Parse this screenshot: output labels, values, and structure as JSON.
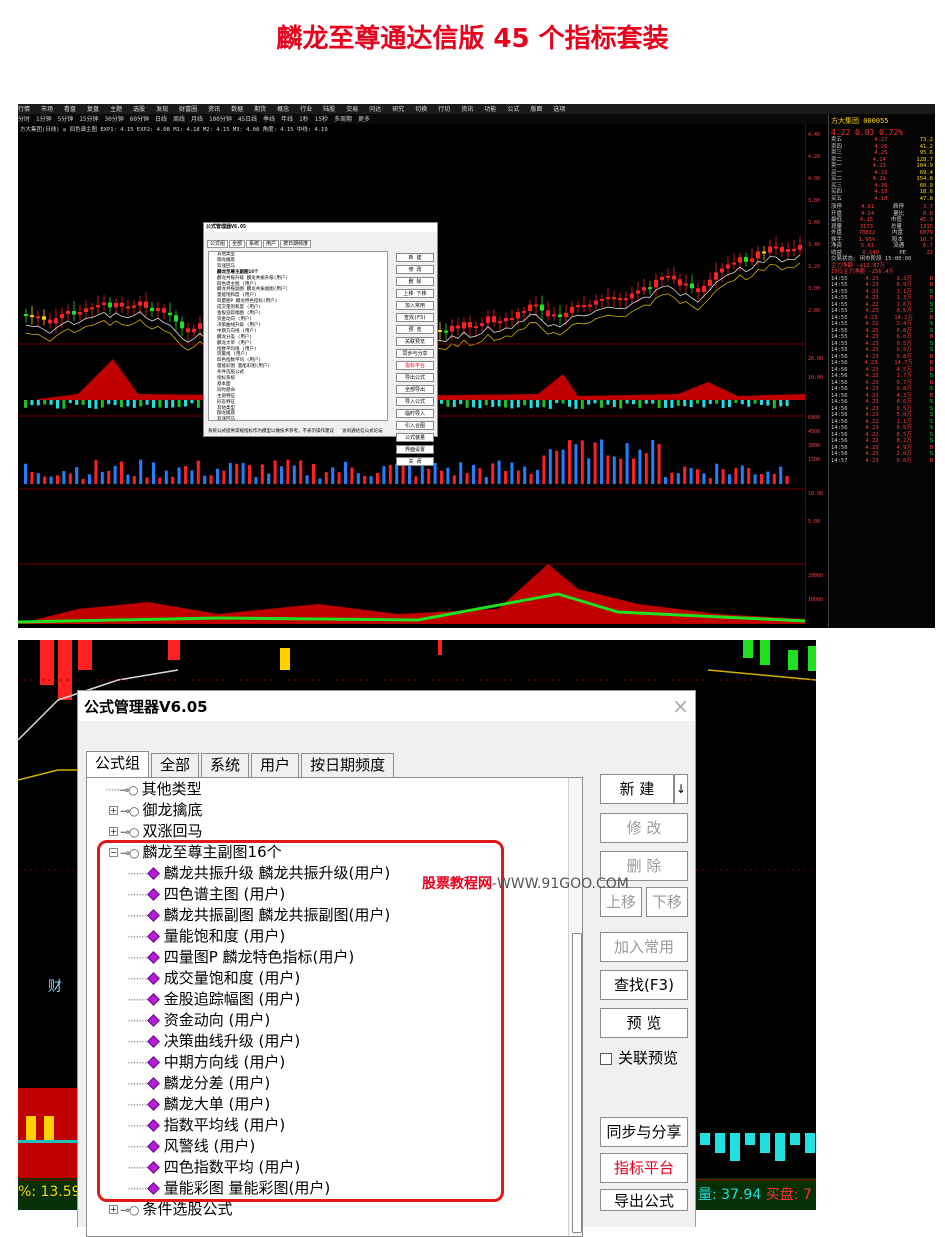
{
  "title": "麟龙至尊通达信版 45 个指标套装",
  "shot1": {
    "menu": [
      "行情",
      "市场",
      "看盘",
      "复盘",
      "主题",
      "选股",
      "发现",
      "财富圈",
      "资讯",
      "数据",
      "期货",
      "概念",
      "行业",
      "陆股",
      "交易",
      "问达",
      "研究",
      "切换",
      "行切",
      "资讯"
    ],
    "menu_right": [
      "功能",
      "公式",
      "版面",
      "选项"
    ],
    "toolbar": [
      "分时",
      "1分钟",
      "5分钟",
      "15分钟",
      "30分钟",
      "60分钟",
      "日线",
      "周线",
      "月线",
      "100分钟",
      "45日线",
      "季线",
      "年线",
      "1秒",
      "15秒",
      "多周期",
      "更多"
    ],
    "indicator_line": "方大集团(日线) ◎ 四色谱主图 EXP1: 4.15 EXP2: 4.08 M1: 4.18 M2: 4.15 M3: 4.08 角度: 4.15 中线: 4.19",
    "stock_name": "方大集团 000055",
    "price_line": "4.22  0.03  0.72%",
    "order_book": [
      [
        "卖五",
        "4.27",
        "73.2"
      ],
      [
        "卖四",
        "4.26",
        "41.2"
      ],
      [
        "卖三",
        "4.25",
        "95.6"
      ],
      [
        "卖二",
        "4.24",
        "128.7"
      ],
      [
        "卖一",
        "4.23",
        "104.9"
      ],
      [
        "买一",
        "4.22",
        "69.4"
      ],
      [
        "买二",
        "4.21",
        "154.8"
      ],
      [
        "买三",
        "4.20",
        "60.9"
      ],
      [
        "买四",
        "4.19",
        "18.6"
      ],
      [
        "买五",
        "4.18",
        "47.8"
      ]
    ],
    "stats": [
      [
        "涨停",
        "4.61",
        "跌停",
        "3.7"
      ],
      [
        "开盘",
        "4.24",
        "量比",
        "0.8"
      ],
      [
        "最低",
        "4.15",
        "市值",
        "45.3"
      ],
      [
        "现量",
        "3173",
        "总量",
        "1315"
      ],
      [
        "外盘",
        "70812",
        "内盘",
        "6079"
      ],
      [
        "换手",
        "1.95%",
        "股本",
        "10.7"
      ],
      [
        "净资",
        "5.61",
        "流通",
        "6.7"
      ],
      [
        "收益",
        "0.140",
        "PE",
        "22"
      ]
    ],
    "status_line": "交易状态: 闭市阶段 15:00:00",
    "flow1": "主力净额 -$13.87万",
    "flow2": "10日主力净额 -256.4万",
    "axis_labels": [
      "4.40",
      "4.20",
      "4.00",
      "3.80",
      "3.60",
      "3.40",
      "3.20",
      "3.00",
      "2.80",
      "20.00",
      "10.00",
      "6000",
      "4500",
      "3000",
      "1500",
      "10.00",
      "5.00",
      "20000",
      "10000"
    ],
    "high_label": "4.57",
    "low_label": "3.15",
    "pane_labels": [
      "主力资金 0.76",
      "成交量和幅度 量: 131566.00 资金净收支: 752.00 成交近剩幅: 13.59",
      "麟龙共振升级",
      "量能彩图 MA1: 144783.25 MA2: 122054.26 MA3: 107160.82"
    ],
    "small_dialog": {
      "title": "公式管理器V6.05",
      "tabs": [
        "公式组",
        "全部",
        "系统",
        "用户",
        "按日期频度"
      ],
      "tree": [
        "其他类型",
        "御龙擒底",
        "双涨回马",
        "麟龙至尊主副图16个",
        "麟龙共振升级 麟龙共振升级(用户)",
        "四色谱主图 (用户)",
        "麟龙共振副图 麟龙共振副图(用户)",
        "量能饱和度 (用户)",
        "四量图P 麟龙特色指标(用户)",
        "成交量饱和度 (用户)",
        "金股追踪幅图 (用户)",
        "资金动向 (用户)",
        "决策曲线升级 (用户)",
        "中期方向线 (用户)",
        "麟龙分差 (用户)",
        "麟龙大单 (用户)",
        "指数平均线 (用户)",
        "风警线 (用户)",
        "四色指数平均 (用户)",
        "量能彩图 量能彩图(用户)",
        "条件选股公式",
        "指标系统",
        "基本面",
        "同时盘命",
        "主助特征",
        "形态特征",
        "其他类型",
        "御龙擒底",
        "双涨回马",
        "麟龙至尊副图3个",
        "决策曲线信号 (用户)",
        "金股追踪 金股追踪幅图外图(用户)",
        "四量买红 第一天(用户)",
        "四色变红 四色谱变红第一天(用户)"
      ],
      "buttons": [
        "新 建",
        "修 改",
        "删 除",
        "上移  下移",
        "加入常用",
        "查找(F3)",
        "预 览",
        "关联预览",
        "同步与分享",
        "指标平台",
        "导出公式",
        "全部导出",
        "导入公式",
        "临时导入",
        "引入合图",
        "公式装量",
        "界面设置",
        "关 闭"
      ],
      "status": "系统公式提供常规指标作为模型以做技术参考，不表示操作建议",
      "status2": "访问通达信公式论坛"
    },
    "tick_rows": [
      [
        "14:55",
        "4.23",
        "3.3万",
        "B"
      ],
      [
        "14:55",
        "4.23",
        "6.9万",
        "B"
      ],
      [
        "14:55",
        "4.23",
        "1.1万",
        "S"
      ],
      [
        "14:55",
        "4.23",
        "1.3万",
        "B"
      ],
      [
        "14:55",
        "4.22",
        "1.6万",
        "S"
      ],
      [
        "14:55",
        "4.23",
        "0.5万",
        "S"
      ],
      [
        "14:55",
        "4.23",
        "14.2万",
        "B"
      ],
      [
        "14:55",
        "4.22",
        "2.4万",
        "S"
      ],
      [
        "14:55",
        "4.23",
        "0.8万",
        "S"
      ],
      [
        "14:55",
        "4.23",
        "6.0万",
        "B"
      ],
      [
        "14:55",
        "4.23",
        "0.5万",
        "S"
      ],
      [
        "14:55",
        "4.23",
        "0.5万",
        "S"
      ],
      [
        "14:56",
        "4.23",
        "0.8万",
        "B"
      ],
      [
        "14:56",
        "4.23",
        "14.7万",
        "B"
      ],
      [
        "14:56",
        "4.23",
        "4.5万",
        "B"
      ],
      [
        "14:56",
        "4.23",
        "1.7万",
        "S"
      ],
      [
        "14:56",
        "4.23",
        "0.7万",
        "B"
      ],
      [
        "14:56",
        "4.23",
        "0.8万",
        "S"
      ],
      [
        "14:56",
        "4.23",
        "4.3万",
        "B"
      ],
      [
        "14:56",
        "4.23",
        "0.6万",
        "S"
      ],
      [
        "14:56",
        "4.23",
        "0.5万",
        "S"
      ],
      [
        "14:56",
        "4.23",
        "5.0万",
        "S"
      ],
      [
        "14:56",
        "4.22",
        "1.1万",
        "S"
      ],
      [
        "14:56",
        "4.23",
        "0.5万",
        "S"
      ],
      [
        "14:56",
        "4.22",
        "8.5万",
        "S"
      ],
      [
        "14:56",
        "4.22",
        "0.2万",
        "S"
      ],
      [
        "14:56",
        "4.23",
        "4.9万",
        "B"
      ],
      [
        "14:56",
        "4.23",
        "2.0万",
        "S"
      ],
      [
        "14:57",
        "4.23",
        "0.0万",
        "B"
      ]
    ]
  },
  "shot2": {
    "side_text": "财",
    "pct_text": "%: 13.59",
    "vol_text": "量: 37.94",
    "vol_text2": "买盘: 7",
    "dialog": {
      "title": "公式管理器V6.05",
      "close": "×",
      "tabs": [
        "公式组",
        "全部",
        "系统",
        "用户",
        "按日期频度"
      ],
      "tree_groups": [
        "其他类型",
        "御龙擒底",
        "双涨回马",
        "麟龙至尊主副图16个"
      ],
      "tree_items": [
        "麟龙共振升级   麟龙共振升级(用户)",
        "四色谱主图  (用户)",
        "麟龙共振副图   麟龙共振副图(用户)",
        "量能饱和度  (用户)",
        "四量图P   麟龙特色指标(用户)",
        "成交量饱和度  (用户)",
        "金股追踪幅图  (用户)",
        "资金动向  (用户)",
        "决策曲线升级  (用户)",
        "中期方向线  (用户)",
        "麟龙分差  (用户)",
        "麟龙大单  (用户)",
        "指数平均线  (用户)",
        "风警线  (用户)",
        "四色指数平均  (用户)",
        "量能彩图   量能彩图(用户)"
      ],
      "tree_after": "条件选股公式",
      "buttons": {
        "new": "新  建",
        "modify": "修  改",
        "delete": "删  除",
        "up": "上移",
        "down": "下移",
        "add_common": "加入常用",
        "find": "查找(F3)",
        "preview": "预  览",
        "linked_preview": "关联预览",
        "sync_share": "同步与分享",
        "indicator_platform": "指标平台",
        "export": "导出公式"
      }
    },
    "watermark_brand": "股票教程网",
    "watermark_url": "-WWW.91GOO.COM"
  }
}
